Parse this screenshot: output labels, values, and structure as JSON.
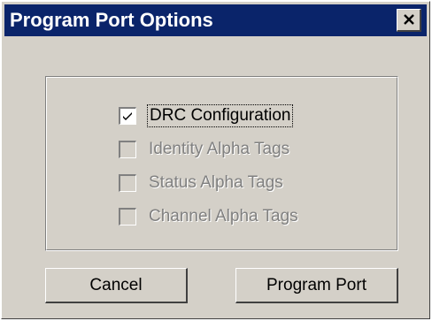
{
  "window": {
    "title": "Program Port Options"
  },
  "titlebar": {
    "close_icon": "close-icon"
  },
  "options": [
    {
      "label": "DRC Configuration",
      "checked": true,
      "enabled": true
    },
    {
      "label": "Identity Alpha Tags",
      "checked": false,
      "enabled": false
    },
    {
      "label": "Status Alpha Tags",
      "checked": false,
      "enabled": false
    },
    {
      "label": "Channel Alpha Tags",
      "checked": false,
      "enabled": false
    }
  ],
  "buttons": {
    "cancel_label": "Cancel",
    "program_label": "Program Port"
  },
  "colors": {
    "titlebar": "#0a246a",
    "face": "#d4d0c8",
    "disabled_text": "#808080"
  }
}
